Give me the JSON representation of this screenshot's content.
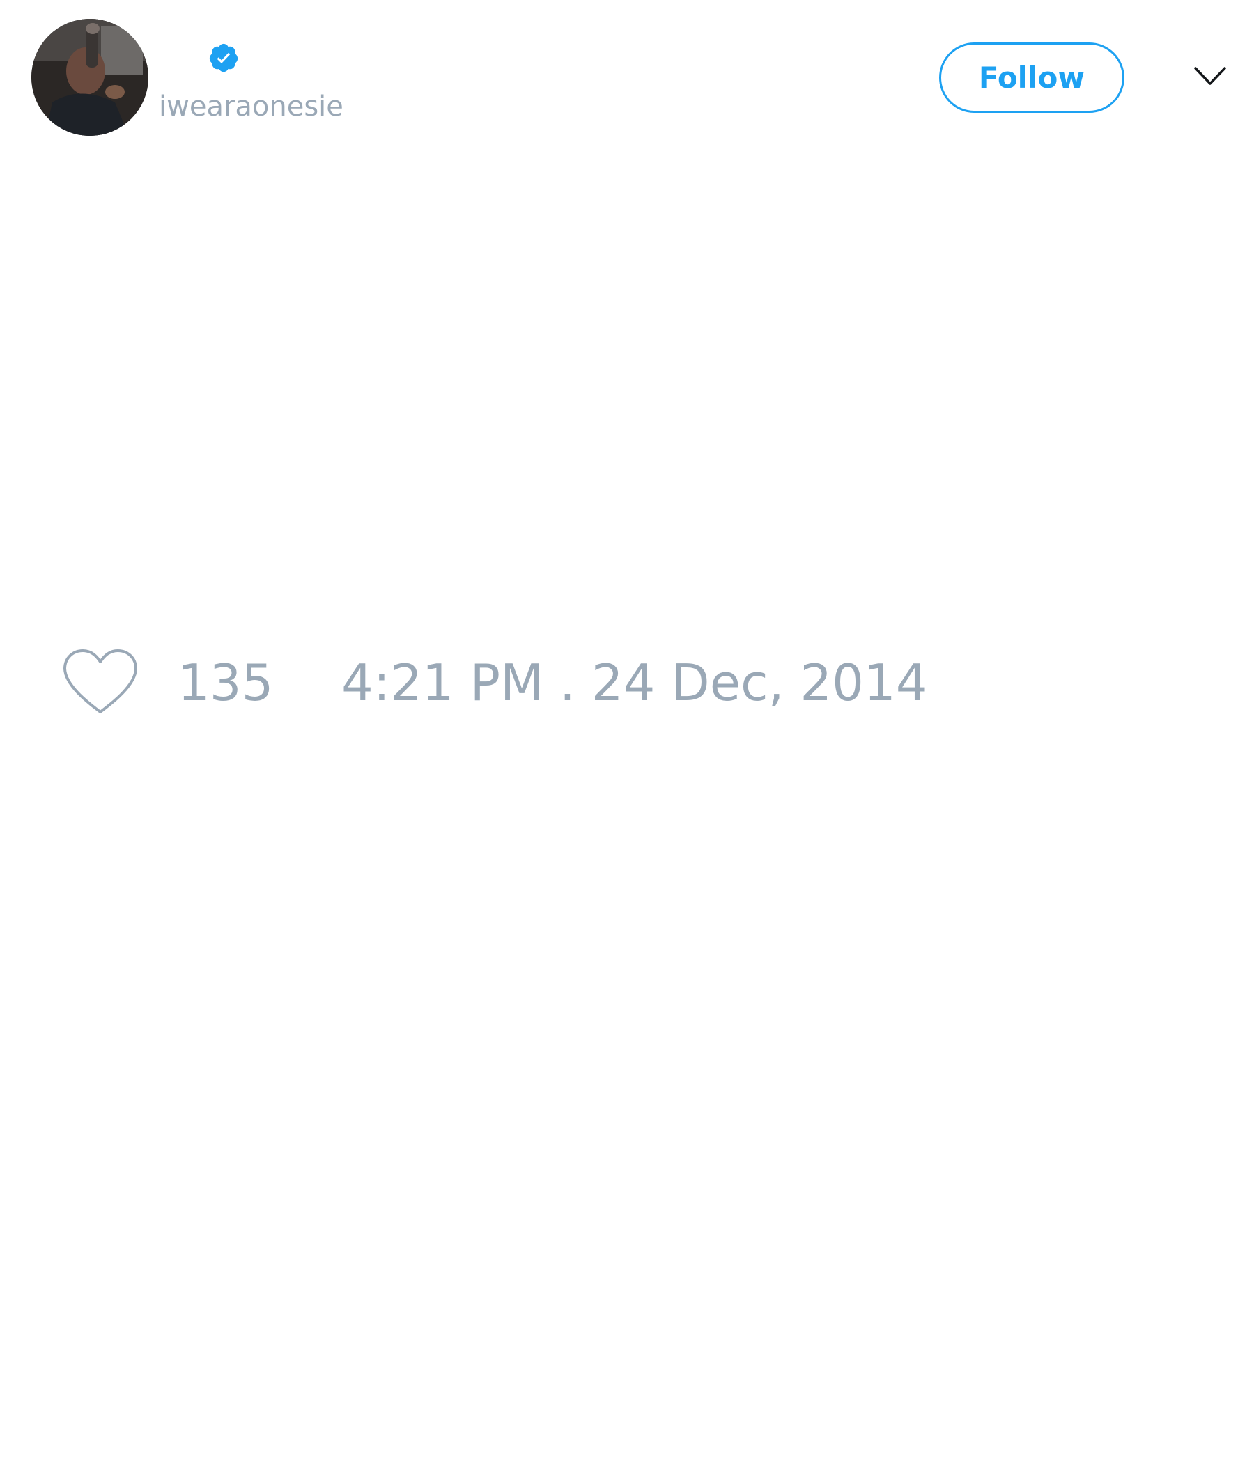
{
  "colors": {
    "accent": "#1da1f2",
    "muted_text": "#9aa8b6",
    "icon_dark": "#14171a"
  },
  "author": {
    "avatar_icon": "profile-photo",
    "verified_icon": "verified-badge-icon",
    "handle": "iwearaonesie"
  },
  "actions": {
    "follow_label": "Follow",
    "menu_icon": "chevron-down-icon"
  },
  "footer": {
    "like_icon": "heart-icon",
    "like_count": "135",
    "timestamp": "4:21 PM . 24 Dec, 2014"
  }
}
